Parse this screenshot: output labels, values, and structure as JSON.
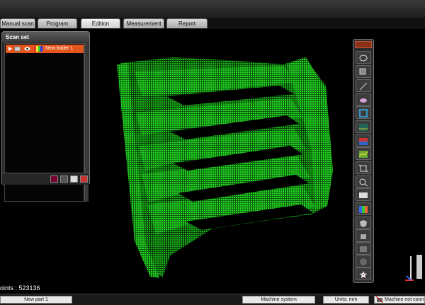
{
  "tabs": [
    {
      "label": "Manual scan"
    },
    {
      "label": "Program"
    },
    {
      "label": "Edition"
    },
    {
      "label": "Measurement"
    },
    {
      "label": "Report"
    }
  ],
  "active_tab": "Edition",
  "scan_set": {
    "title": "Scan set",
    "items": [
      {
        "label": "New folder 1",
        "selected": true
      }
    ]
  },
  "viewport": {
    "points_label": "oints : 523136",
    "pointcloud_color": "#1ed11e"
  },
  "statusbar": {
    "part": "New part 1",
    "coordinate_system": "Machine system",
    "units": "Units: mm",
    "machine_status": "Machine not conn"
  },
  "colors": {
    "accent": "#e4561e",
    "cloud": "#22dd22"
  }
}
